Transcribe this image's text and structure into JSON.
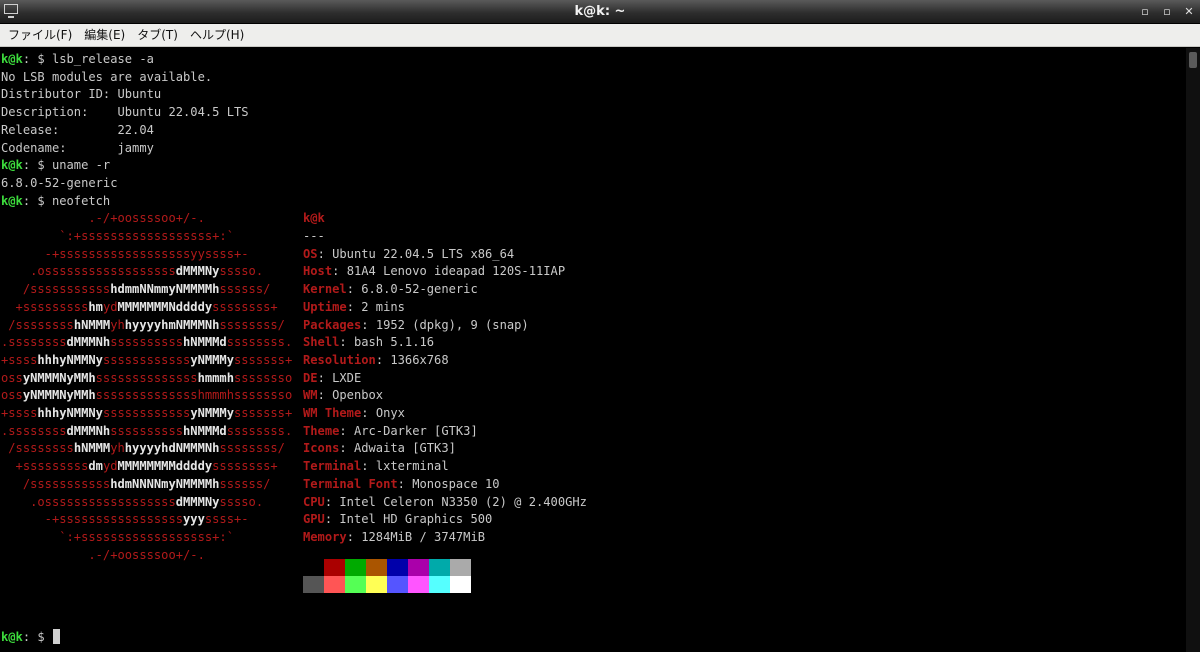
{
  "window": {
    "title": "k@k: ~",
    "minimize": "▫",
    "maximize": "▫",
    "close": "✕"
  },
  "menu": [
    {
      "label": "ファイル(F)"
    },
    {
      "label": "編集(E)"
    },
    {
      "label": "タブ(T)"
    },
    {
      "label": "ヘルプ(H)"
    }
  ],
  "prompt": {
    "user": "k@k",
    "rest": ": $ "
  },
  "lines": [
    {
      "type": "prompt",
      "cmd": "lsb_release -a"
    },
    {
      "type": "out",
      "text": "No LSB modules are available."
    },
    {
      "type": "out",
      "text": "Distributor ID:\tUbuntu"
    },
    {
      "type": "out",
      "text": "Description:\tUbuntu 22.04.5 LTS"
    },
    {
      "type": "out",
      "text": "Release:\t22.04"
    },
    {
      "type": "out",
      "text": "Codename:\tjammy"
    },
    {
      "type": "prompt",
      "cmd": "uname -r"
    },
    {
      "type": "out",
      "text": "6.8.0-52-generic"
    },
    {
      "type": "prompt",
      "cmd": "neofetch"
    }
  ],
  "ascii_art": [
    [
      [
        "r",
        "            .-/+oossssoo+/-.               "
      ]
    ],
    [
      [
        "r",
        "        `:+ssssssssssssssssss+:`           "
      ]
    ],
    [
      [
        "r",
        "      -+ssssssssssssssssssyyssss+-         "
      ]
    ],
    [
      [
        "r",
        "    .ossssssssssssssssss"
      ],
      [
        "w",
        "dMMMNy"
      ],
      [
        "r",
        "sssso.       "
      ]
    ],
    [
      [
        "r",
        "   /sssssssssss"
      ],
      [
        "w",
        "hdmmNNmmyNMMMMh"
      ],
      [
        "r",
        "ssssss/      "
      ]
    ],
    [
      [
        "r",
        "  +sssssssss"
      ],
      [
        "w",
        "hm"
      ],
      [
        "r",
        "yd"
      ],
      [
        "w",
        "MMMMMMMNddddy"
      ],
      [
        "r",
        "ssssssss+     "
      ]
    ],
    [
      [
        "r",
        " /ssssssss"
      ],
      [
        "w",
        "hNMMM"
      ],
      [
        "r",
        "yh"
      ],
      [
        "w",
        "hyyyyhmNMMMNh"
      ],
      [
        "r",
        "ssssssss/    "
      ]
    ],
    [
      [
        "r",
        ".ssssssss"
      ],
      [
        "w",
        "dMMMNh"
      ],
      [
        "r",
        "ssssssssss"
      ],
      [
        "w",
        "hNMMMd"
      ],
      [
        "r",
        "ssssssss.    "
      ]
    ],
    [
      [
        "r",
        "+ssss"
      ],
      [
        "w",
        "hhhyNMMNy"
      ],
      [
        "r",
        "ssssssssssss"
      ],
      [
        "w",
        "yNMMMy"
      ],
      [
        "r",
        "sssssss+    "
      ]
    ],
    [
      [
        "r",
        "oss"
      ],
      [
        "w",
        "yNMMMNyMMh"
      ],
      [
        "r",
        "ssssssssssssss"
      ],
      [
        "w",
        "hmmmh"
      ],
      [
        "r",
        "ssssssso    "
      ]
    ],
    [
      [
        "r",
        "oss"
      ],
      [
        "w",
        "yNMMMNyMMh"
      ],
      [
        "r",
        "sssssssssssssshmmmhssssssso    "
      ]
    ],
    [
      [
        "r",
        "+ssss"
      ],
      [
        "w",
        "hhhyNMMNy"
      ],
      [
        "r",
        "ssssssssssss"
      ],
      [
        "w",
        "yNMMMy"
      ],
      [
        "r",
        "sssssss+    "
      ]
    ],
    [
      [
        "r",
        ".ssssssss"
      ],
      [
        "w",
        "dMMMNh"
      ],
      [
        "r",
        "ssssssssss"
      ],
      [
        "w",
        "hNMMMd"
      ],
      [
        "r",
        "ssssssss.    "
      ]
    ],
    [
      [
        "r",
        " /ssssssss"
      ],
      [
        "w",
        "hNMMM"
      ],
      [
        "r",
        "yh"
      ],
      [
        "w",
        "hyyyyhdNMMMNh"
      ],
      [
        "r",
        "ssssssss/    "
      ]
    ],
    [
      [
        "r",
        "  +sssssssss"
      ],
      [
        "w",
        "dm"
      ],
      [
        "r",
        "yd"
      ],
      [
        "w",
        "MMMMMMMMddddy"
      ],
      [
        "r",
        "ssssssss+     "
      ]
    ],
    [
      [
        "r",
        "   /sssssssssss"
      ],
      [
        "w",
        "hdmNNNNmyNMMMMh"
      ],
      [
        "r",
        "ssssss/      "
      ]
    ],
    [
      [
        "r",
        "    .ossssssssssssssssss"
      ],
      [
        "w",
        "dMMMNy"
      ],
      [
        "r",
        "sssso.       "
      ]
    ],
    [
      [
        "r",
        "      -+sssssssssssssssss"
      ],
      [
        "w",
        "yyy"
      ],
      [
        "r",
        "ssss+-         "
      ]
    ],
    [
      [
        "r",
        "        `:+ssssssssssssssssss+:`           "
      ]
    ],
    [
      [
        "r",
        "            .-/+oossssoo+/-.               "
      ]
    ]
  ],
  "neofetch": {
    "header": "k@k",
    "separator": "---",
    "fields": [
      {
        "key": "OS",
        "value": "Ubuntu 22.04.5 LTS x86_64"
      },
      {
        "key": "Host",
        "value": "81A4 Lenovo ideapad 120S-11IAP"
      },
      {
        "key": "Kernel",
        "value": "6.8.0-52-generic"
      },
      {
        "key": "Uptime",
        "value": "2 mins"
      },
      {
        "key": "Packages",
        "value": "1952 (dpkg), 9 (snap)"
      },
      {
        "key": "Shell",
        "value": "bash 5.1.16"
      },
      {
        "key": "Resolution",
        "value": "1366x768"
      },
      {
        "key": "DE",
        "value": "LXDE"
      },
      {
        "key": "WM",
        "value": "Openbox"
      },
      {
        "key": "WM Theme",
        "value": "Onyx"
      },
      {
        "key": "Theme",
        "value": "Arc-Darker [GTK3]"
      },
      {
        "key": "Icons",
        "value": "Adwaita [GTK3]"
      },
      {
        "key": "Terminal",
        "value": "lxterminal"
      },
      {
        "key": "Terminal Font",
        "value": "Monospace 10"
      },
      {
        "key": "CPU",
        "value": "Intel Celeron N3350 (2) @ 2.400GHz"
      },
      {
        "key": "GPU",
        "value": "Intel HD Graphics 500"
      },
      {
        "key": "Memory",
        "value": "1284MiB / 3747MiB"
      }
    ],
    "palette_top": [
      "#000000",
      "#aa0000",
      "#00aa00",
      "#aa5500",
      "#0000aa",
      "#aa00aa",
      "#00aaaa",
      "#aaaaaa"
    ],
    "palette_bottom": [
      "#555555",
      "#ff5555",
      "#55ff55",
      "#ffff55",
      "#5555ff",
      "#ff55ff",
      "#55ffff",
      "#ffffff"
    ]
  },
  "colors": {
    "prompt_user": "#3ddc3d",
    "key": "#b21a1a",
    "text": "#c9c9c9"
  }
}
